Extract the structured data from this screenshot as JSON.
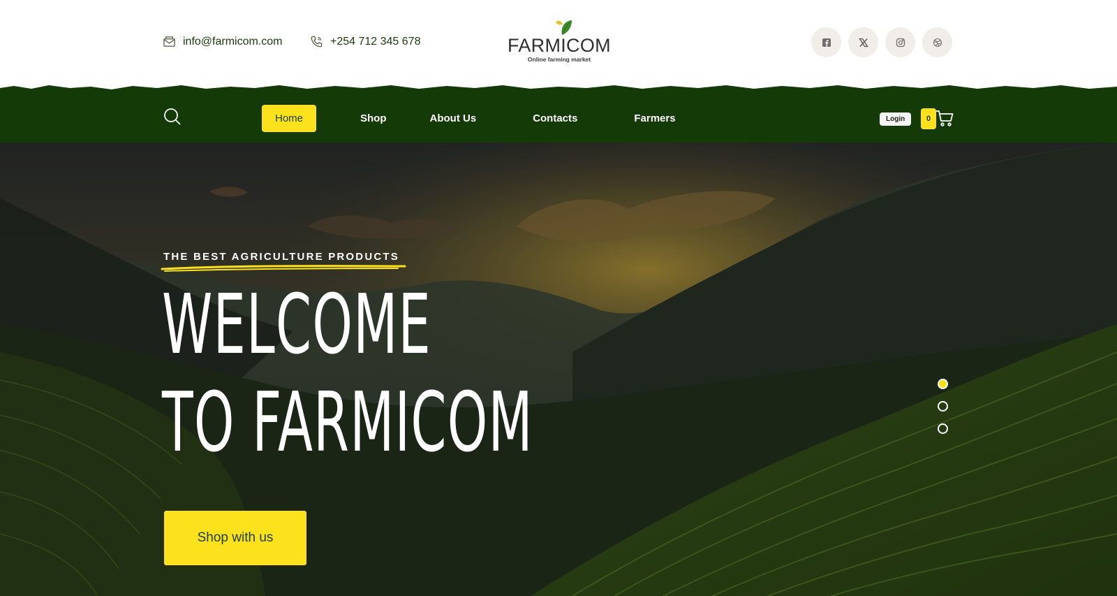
{
  "contact": {
    "email": "info@farmicom.com",
    "phone": "+254 712 345 678"
  },
  "brand": {
    "name": "FARMICOM",
    "tagline": "Online farming market"
  },
  "socials": [
    "facebook-icon",
    "x-icon",
    "instagram-icon",
    "dribbble-icon"
  ],
  "nav": {
    "items": [
      {
        "label": "Home",
        "active": true
      },
      {
        "label": "Shop"
      },
      {
        "label": "About Us"
      },
      {
        "label": "Contacts"
      },
      {
        "label": "Farmers"
      }
    ],
    "login_label": "Login",
    "cart_count": "0"
  },
  "hero": {
    "kicker": "THE BEST AGRICULTURE PRODUCTS",
    "headline_line1": "WELCOME",
    "headline_line2": "TO FARMICOM",
    "cta_label": "Shop with us",
    "slides": 3,
    "active_slide": 1
  },
  "colors": {
    "accent": "#fce21c",
    "nav_green": "#143a08",
    "text_dark": "#1b3a0c"
  }
}
